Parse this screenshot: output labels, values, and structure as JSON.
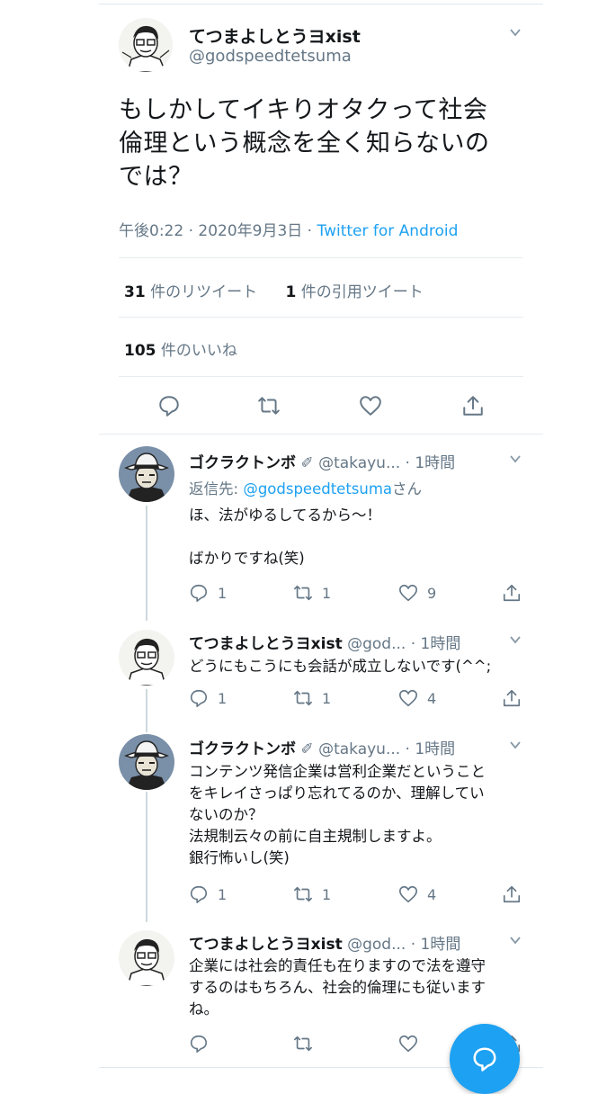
{
  "main_tweet": {
    "name": "てつまよしとうヨxist",
    "handle": "@godspeedtetsuma",
    "text_lines": [
      "もしかしてイキりオタクって社会",
      "倫理という概念を全く知らないの",
      "では？"
    ],
    "time": "午後0:22 · 2020年9月3日 · ",
    "source": "Twitter for Android",
    "retweet_count": "31",
    "retweet_label": " 件のリツイート",
    "quote_count": "1",
    "quote_label": " 件の引用ツイート",
    "like_count": "105",
    "like_label": " 件のいいね"
  },
  "replies": [
    {
      "name": "ゴクラクトンボ",
      "handle": "@takayu...",
      "time": " · 1時間",
      "reply_to_prefix": "返信先: ",
      "reply_to_handle": "@godspeedtetsuma",
      "reply_to_suffix": "さん",
      "text": "ほ、法がゆるしてるから〜！\n\nばかりですね(笑)",
      "reply_count": "1",
      "retweet_count": "1",
      "like_count": "9"
    },
    {
      "name": "てつまよしとうヨxist",
      "handle": "@god...",
      "time": " · 1時間",
      "text": "どうにもこうにも会話が成立しないです(^^;",
      "reply_count": "1",
      "retweet_count": "1",
      "like_count": "4"
    },
    {
      "name": "ゴクラクトンボ",
      "handle": "@takayu...",
      "time": " · 1時間",
      "text": "コンテンツ発信企業は営利企業だということ\nをキレイさっぱり忘れてるのか、理解してい\nないのか？\n法規制云々の前に自主規制しますよ。\n銀行怖いし(笑)",
      "reply_count": "1",
      "retweet_count": "1",
      "like_count": "4"
    },
    {
      "name": "てつまよしとうヨxist",
      "handle": "@god...",
      "time": " · 1時間",
      "text": "企業には社会的責任も在りますので法を遵守\nするのはもちろん、社会的倫理にも従います\nね。",
      "reply_count": "",
      "retweet_count": "",
      "like_count": ""
    }
  ],
  "colors": {
    "accent": "#1da1f2",
    "muted": "#657786",
    "text": "#14171a",
    "divider": "#e6ecf0"
  }
}
